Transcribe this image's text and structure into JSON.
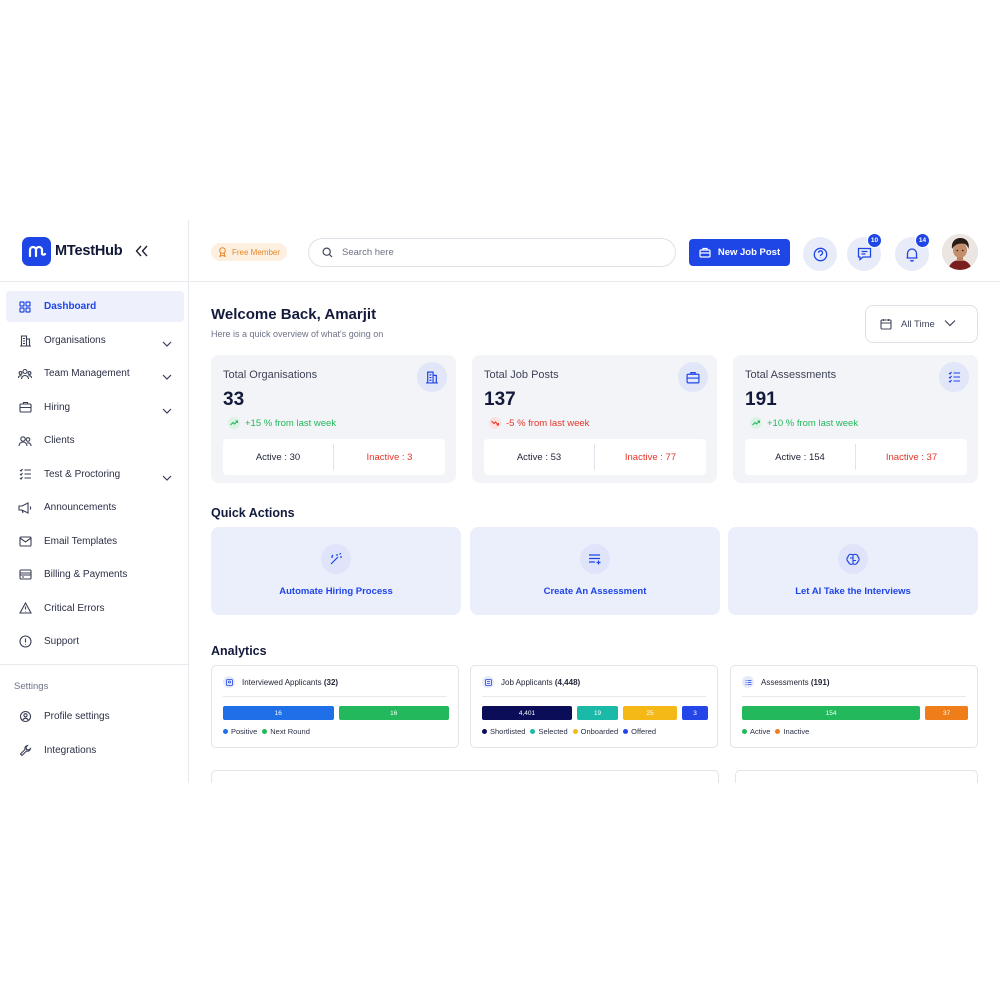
{
  "brand": {
    "name": "MTestHub"
  },
  "sidebar": {
    "items": [
      {
        "label": "Dashboard",
        "icon": "dashboard-grid-icon",
        "active": true
      },
      {
        "label": "Organisations",
        "icon": "building-icon",
        "has_submenu": true
      },
      {
        "label": "Team Management",
        "icon": "team-icon",
        "has_submenu": true
      },
      {
        "label": "Hiring",
        "icon": "briefcase-icon",
        "has_submenu": true
      },
      {
        "label": "Clients",
        "icon": "users-icon"
      },
      {
        "label": "Test & Proctoring",
        "icon": "checklist-icon",
        "has_submenu": true
      },
      {
        "label": "Announcements",
        "icon": "megaphone-icon"
      },
      {
        "label": "Email Templates",
        "icon": "mail-icon"
      },
      {
        "label": "Billing & Payments",
        "icon": "credit-card-icon"
      },
      {
        "label": "Critical Errors",
        "icon": "warning-icon"
      },
      {
        "label": "Support",
        "icon": "support-icon"
      }
    ],
    "settings_title": "Settings",
    "settings_items": [
      {
        "label": "Profile settings",
        "icon": "gear-user-icon"
      },
      {
        "label": "Integrations",
        "icon": "wrench-icon"
      }
    ]
  },
  "topbar": {
    "member_badge": "Free Member",
    "search_placeholder": "Search here",
    "new_job_label": "New Job Post",
    "messages_count": "10",
    "notifications_count": "14"
  },
  "main": {
    "welcome": "Welcome Back, Amarjit",
    "subtitle": "Here is a quick overview of what's going on",
    "time_filter": "All Time",
    "stats": [
      {
        "title": "Total Organisations",
        "value": "33",
        "change": "+15 % from last week",
        "trend": "up",
        "active": "Active : 30",
        "inactive": "Inactive : 3",
        "icon": "building-icon"
      },
      {
        "title": "Total Job Posts",
        "value": "137",
        "change": "-5 % from last week",
        "trend": "down",
        "active": "Active : 53",
        "inactive": "Inactive : 77",
        "icon": "briefcase-icon"
      },
      {
        "title": "Total Assessments",
        "value": "191",
        "change": "+10 % from last week",
        "trend": "up",
        "active": "Active : 154",
        "inactive": "Inactive : 37",
        "icon": "checklist-icon"
      }
    ],
    "quick_actions_title": "Quick Actions",
    "quick_actions": [
      {
        "label": "Automate Hiring Process",
        "icon": "magic-wand-icon"
      },
      {
        "label": "Create An Assessment",
        "icon": "list-add-icon"
      },
      {
        "label": "Let AI Take the Interviews",
        "icon": "brain-icon"
      }
    ],
    "analytics_title": "Analytics",
    "analytics": [
      {
        "title": "Interviewed Applicants",
        "count": "(32)",
        "segments": [
          {
            "value": 16,
            "label": "16",
            "name": "Positive",
            "color": "#1f6fe8"
          },
          {
            "value": 16,
            "label": "16",
            "name": "Next Round",
            "color": "#22b85b"
          }
        ]
      },
      {
        "title": "Job Applicants",
        "count": "(4,448)",
        "segments": [
          {
            "value": 4401,
            "label": "4,401",
            "name": "Shortlisted",
            "color": "#0b0d59"
          },
          {
            "value": 19,
            "label": "19",
            "name": "Selected",
            "color": "#1bb9a8"
          },
          {
            "value": 25,
            "label": "25",
            "name": "Onboarded",
            "color": "#f4b817"
          },
          {
            "value": 3,
            "label": "3",
            "name": "Offered",
            "color": "#2446e8"
          }
        ]
      },
      {
        "title": "Assessments",
        "count": "(191)",
        "segments": [
          {
            "value": 154,
            "label": "154",
            "name": "Active",
            "color": "#22b85b"
          },
          {
            "value": 37,
            "label": "37",
            "name": "Inactive",
            "color": "#ef7d1a"
          }
        ]
      }
    ]
  },
  "colors": {
    "accent": "#1e45e6",
    "up": "#22b85b",
    "down": "#e5342b"
  }
}
